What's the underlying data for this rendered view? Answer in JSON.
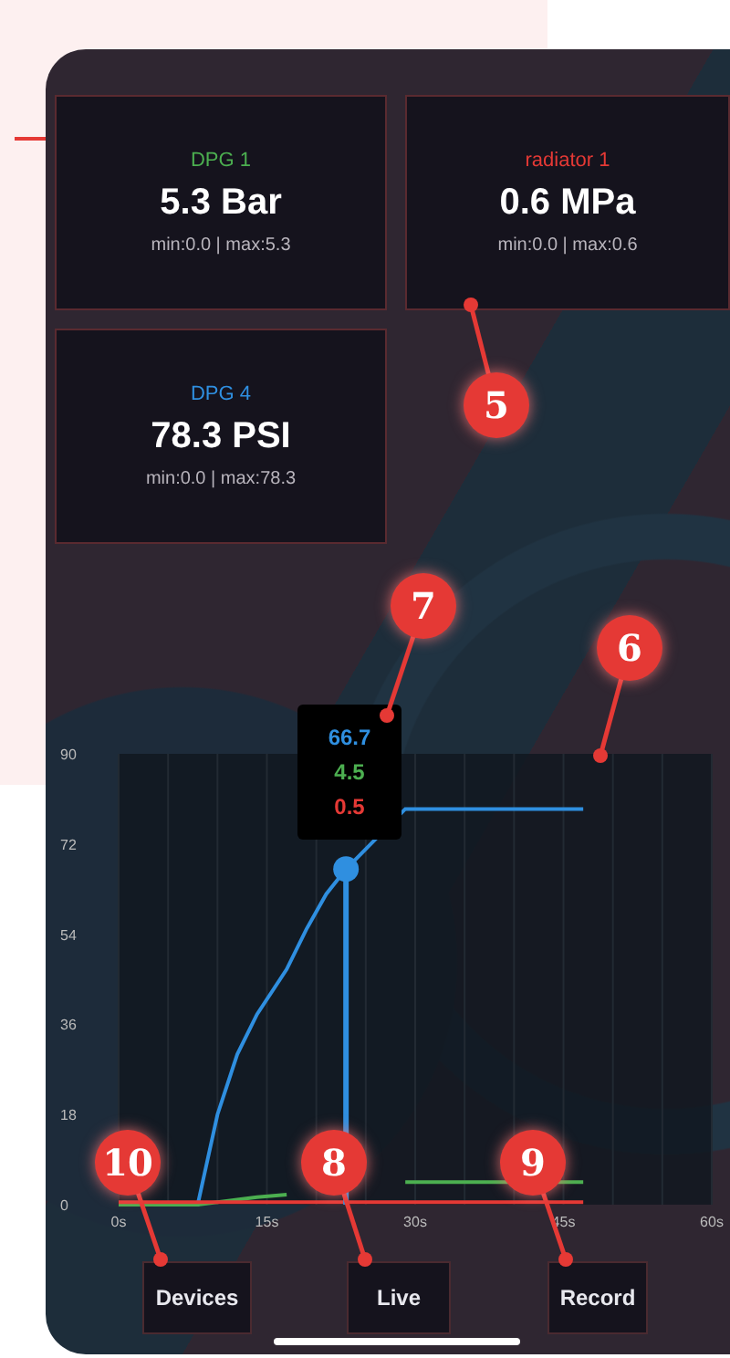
{
  "sensors": [
    {
      "name": "DPG 1",
      "color": "#4caf50",
      "value": "5.3 Bar",
      "range": "min:0.0 | max:5.3"
    },
    {
      "name": "radiator 1",
      "color": "#e53935",
      "value": "0.6 MPa",
      "range": "min:0.0 | max:0.6"
    },
    {
      "name": "DPG 4",
      "color": "#2f8fe0",
      "value": "78.3 PSI",
      "range": "min:0.0 | max:78.3"
    }
  ],
  "chart": {
    "chart_data": {
      "type": "line",
      "x": [
        0,
        5,
        8,
        10,
        12,
        14,
        17,
        19,
        21,
        23,
        29,
        47
      ],
      "grid": true,
      "series": [
        {
          "color": "#2f8fe0",
          "values": [
            0,
            0,
            0,
            18,
            30,
            38,
            47,
            55,
            62,
            67,
            79,
            79
          ]
        },
        {
          "color": "#4caf50",
          "values": [
            0,
            0,
            0,
            0.5,
            1,
            1.5,
            2,
            null,
            null,
            null,
            4.5,
            4.5
          ]
        },
        {
          "color": "#e53935",
          "values": [
            0.5,
            0.5,
            0.5,
            0.5,
            0.5,
            0.5,
            0.5,
            0.5,
            0.5,
            0.5,
            0.5,
            0.5
          ]
        }
      ],
      "xlim": [
        0,
        60
      ],
      "ylim": [
        0,
        90
      ],
      "xticks": [
        {
          "value": 0,
          "label": "0s"
        },
        {
          "value": 15,
          "label": "15s"
        },
        {
          "value": 30,
          "label": "30s"
        },
        {
          "value": 45,
          "label": "45s"
        },
        {
          "value": 60,
          "label": "60s"
        }
      ],
      "yticks": [
        0,
        18,
        36,
        54,
        72,
        90
      ]
    },
    "tooltip": {
      "values": [
        "66.7",
        "4.5",
        "0.5"
      ]
    }
  },
  "buttons": [
    "Devices",
    "Live",
    "Record"
  ],
  "callouts": [
    {
      "label": "5"
    },
    {
      "label": "7"
    },
    {
      "label": "6"
    },
    {
      "label": "10"
    },
    {
      "label": "8"
    },
    {
      "label": "9"
    }
  ]
}
